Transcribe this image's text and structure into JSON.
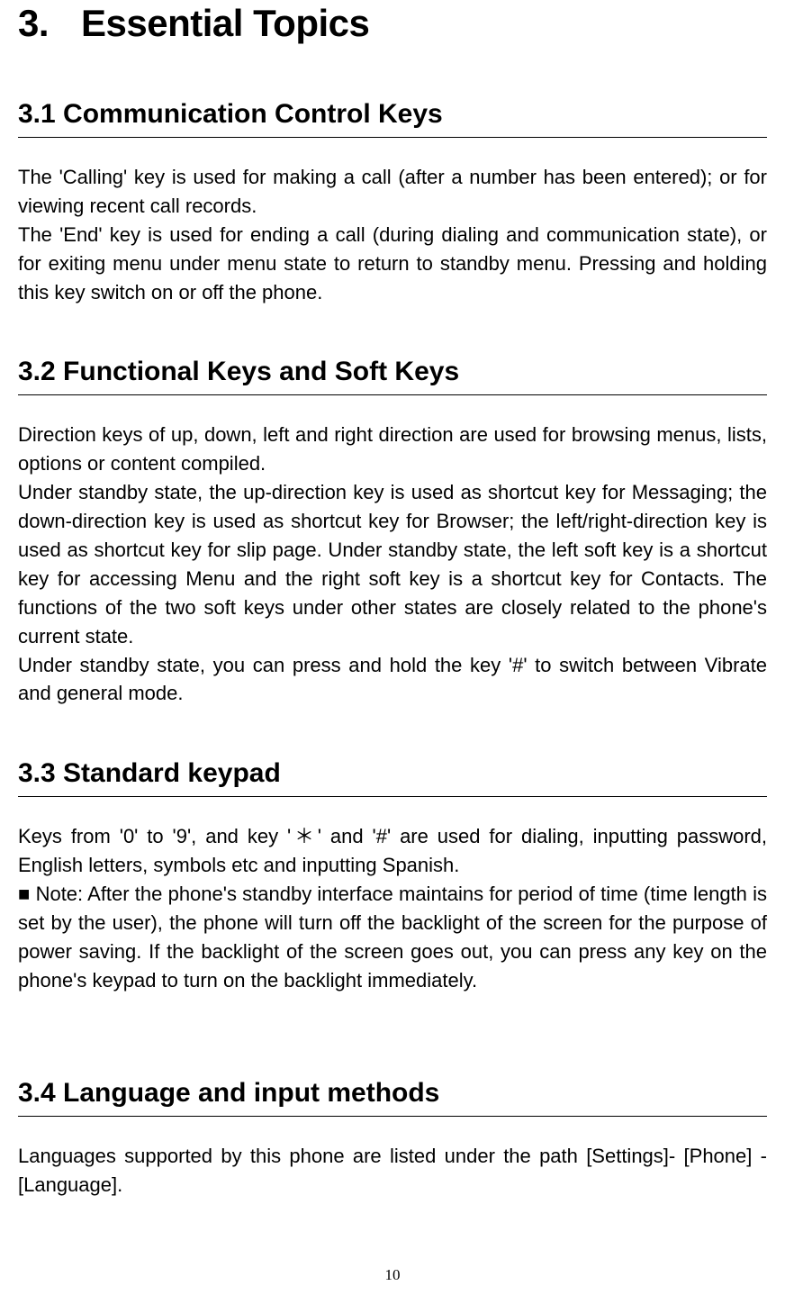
{
  "chapter": {
    "number": "3.",
    "title": "Essential Topics"
  },
  "sections": [
    {
      "title": "3.1 Communication Control Keys",
      "paragraphs": [
        "The 'Calling' key is used for making a call (after a number has been entered); or for viewing recent call records.",
        "The 'End' key is used for ending a call (during dialing and communication state), or for exiting menu under menu state to return to standby menu. Pressing and holding this key switch on or off the phone."
      ]
    },
    {
      "title": "3.2 Functional Keys and Soft Keys",
      "paragraphs": [
        "Direction keys of up, down, left and right direction are used for browsing menus, lists, options or content compiled.",
        "Under standby state, the up-direction key is used as shortcut key for Messaging; the down-direction key is used as shortcut key for Browser; the left/right-direction key is used as shortcut key for slip page. Under standby state, the left soft key is a shortcut key for accessing Menu and the right soft key is a shortcut key for Contacts. The functions of the two soft keys under other states are closely related to the phone's current state.",
        "Under standby state, you can press and hold the key '#' to switch between Vibrate and general mode."
      ]
    },
    {
      "title": "3.3 Standard keypad",
      "paragraphs": [
        "Keys from '0' to '9', and key '＊' and '#' are used for dialing, inputting password, English letters, symbols etc and inputting Spanish.",
        "■ Note: After the phone's standby interface maintains for period of time (time length is set by the user), the phone will turn off the backlight of the screen for the purpose of power saving. If the backlight of the screen goes out, you can press any key on the phone's keypad to turn on the backlight immediately."
      ]
    },
    {
      "title": "3.4 Language and input methods",
      "paragraphs": [
        "Languages supported by this phone are listed under the path [Settings]- [Phone]  - [Language]."
      ]
    }
  ],
  "page_number": "10"
}
